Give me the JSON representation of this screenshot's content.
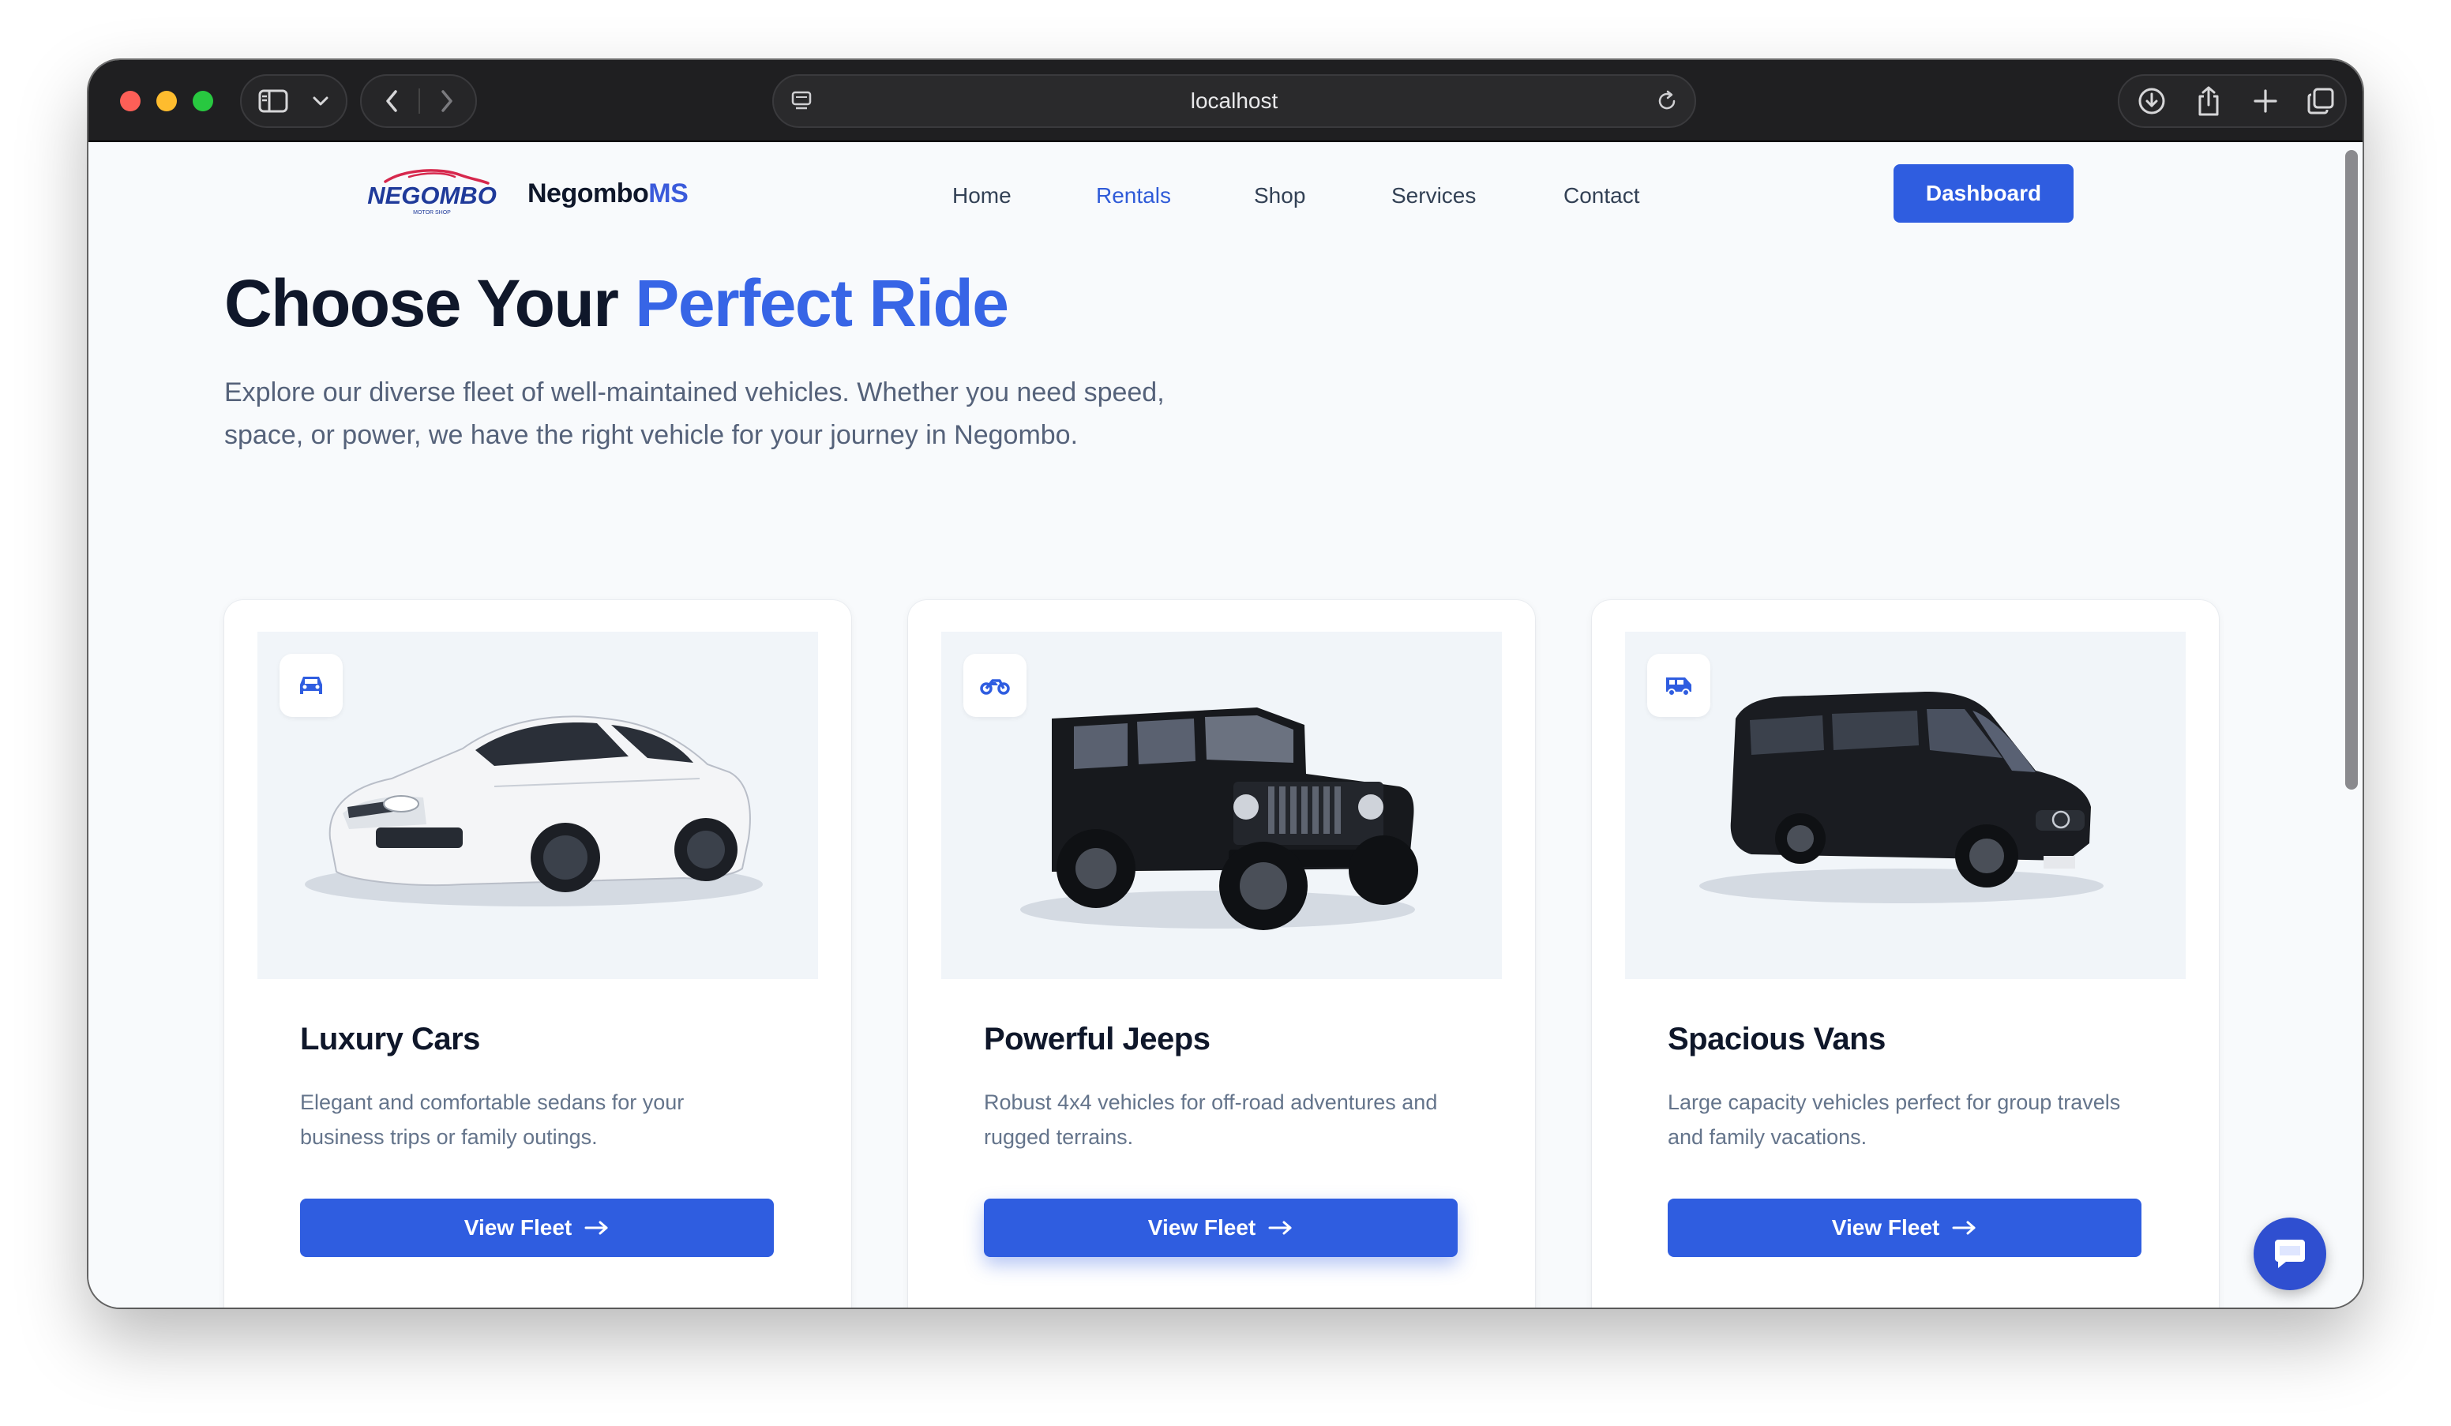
{
  "browser": {
    "url": "localhost"
  },
  "nav": {
    "logo_text": "NEGOMBO",
    "logo_subtext": "MOTOR SHOP",
    "brand_main": "Negombo",
    "brand_accent": "MS",
    "links": [
      "Home",
      "Rentals",
      "Shop",
      "Services",
      "Contact"
    ],
    "active_link": "Rentals",
    "dashboard_label": "Dashboard"
  },
  "hero": {
    "title_main": "Choose Your ",
    "title_accent": "Perfect Ride",
    "description": "Explore our diverse fleet of well-maintained vehicles. Whether you need speed, space, or power, we have the right vehicle for your journey in Negombo."
  },
  "cards": [
    {
      "icon": "car-icon",
      "title": "Luxury Cars",
      "description": "Elegant and comfortable sedans for your business trips or family outings.",
      "button_label": "View Fleet"
    },
    {
      "icon": "motorcycle-icon",
      "title": "Powerful Jeeps",
      "description": "Robust 4x4 vehicles for off-road adventures and rugged terrains.",
      "button_label": "View Fleet"
    },
    {
      "icon": "van-icon",
      "title": "Spacious Vans",
      "description": "Large capacity vehicles perfect for group travels and family vacations.",
      "button_label": "View Fleet"
    }
  ],
  "colors": {
    "accent": "#2f5de0",
    "heading": "#0f172a",
    "muted": "#64748b",
    "page_bg": "#f8fafc"
  }
}
